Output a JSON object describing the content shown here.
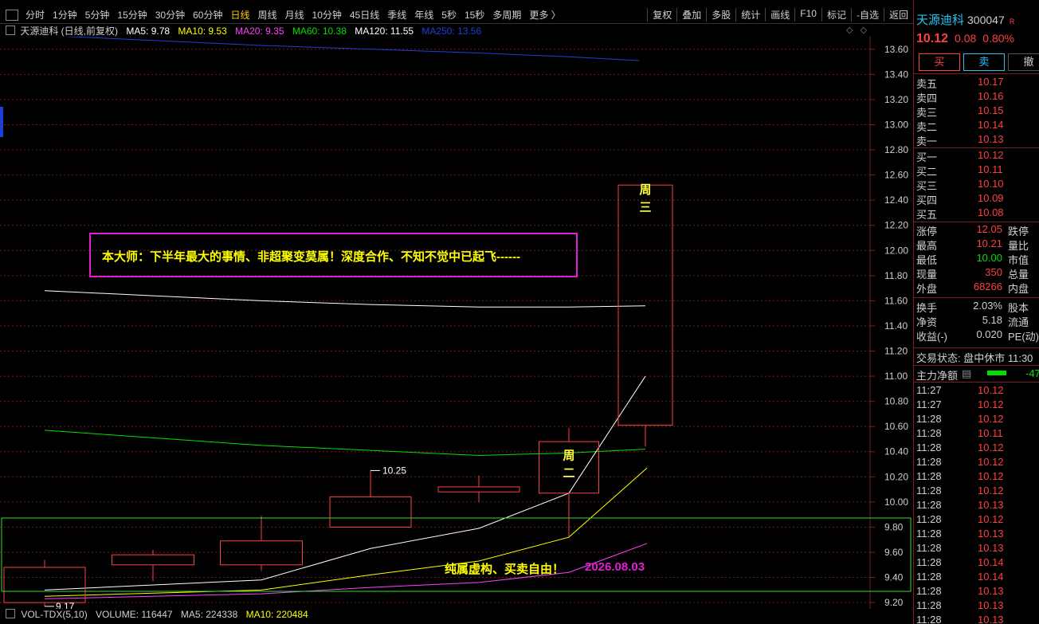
{
  "toolbar": {
    "tabs": [
      "分时",
      "1分钟",
      "5分钟",
      "15分钟",
      "30分钟",
      "60分钟",
      "日线",
      "周线",
      "月线",
      "10分钟",
      "45日线",
      "季线",
      "年线",
      "5秒",
      "15秒",
      "多周期",
      "更多 〉"
    ],
    "active_tab": "日线",
    "right_buttons": [
      "复权",
      "叠加",
      "多股",
      "统计",
      "画线",
      "F10",
      "标记",
      "-自选",
      "返回"
    ]
  },
  "legend": {
    "name": "天源迪科 (日线,前复权)",
    "ma5": "MA5: 9.78",
    "ma10": "MA10: 9.53",
    "ma20": "MA20: 9.35",
    "ma60": "MA60: 10.38",
    "ma120": "MA120: 11.55",
    "ma250": "MA250: 13.56"
  },
  "colors": {
    "up": "#ff4040",
    "down": "#27c2f5",
    "ma5": "#ffffff",
    "ma10": "#ffff00",
    "ma20": "#ff40ff",
    "ma60": "#00e000",
    "ma120": "#ffffff",
    "ma250": "#1d40d8",
    "grid": "#7a1d1d",
    "annot_border": "#e020d0"
  },
  "chart_data": {
    "type": "candlestick",
    "y_axis_ticks": [
      "13.60",
      "13.40",
      "13.20",
      "13.00",
      "12.80",
      "12.60",
      "12.40",
      "12.20",
      "12.00",
      "11.80",
      "11.60",
      "11.40",
      "11.20",
      "11.00",
      "10.80",
      "10.60",
      "10.40",
      "10.20",
      "10.00",
      "9.80",
      "9.60",
      "9.40",
      "9.20"
    ],
    "ylim": [
      9.15,
      13.7
    ],
    "candles": [
      {
        "open": 9.48,
        "close": 9.2,
        "high": 9.54,
        "low": 9.17
      },
      {
        "open": 9.5,
        "close": 9.58,
        "high": 9.62,
        "low": 9.37
      },
      {
        "open": 9.69,
        "close": 9.5,
        "high": 9.89,
        "low": 9.45
      },
      {
        "open": 9.8,
        "close": 10.04,
        "high": 10.25,
        "low": 9.8
      },
      {
        "open": 10.08,
        "close": 10.12,
        "high": 10.21,
        "low": 10.0
      },
      {
        "open": 10.07,
        "close": 10.48,
        "high": 10.59,
        "low": 9.72
      },
      {
        "open": 10.61,
        "close": 12.52,
        "high": 12.52,
        "low": 10.44
      }
    ],
    "high_label": "10.25",
    "low_label": "9.17",
    "ma5": [
      9.3,
      null,
      9.38,
      9.63,
      9.79,
      10.07,
      11.0
    ],
    "ma10": [
      9.25,
      null,
      9.3,
      9.42,
      9.53,
      9.72,
      10.27
    ],
    "ma20": [
      9.23,
      null,
      9.27,
      9.32,
      9.36,
      9.44,
      9.67
    ],
    "ma60": [
      10.57,
      10.51,
      10.45,
      10.41,
      10.37,
      10.39,
      10.42
    ],
    "ma120": [
      11.68,
      11.64,
      11.6,
      11.57,
      11.55,
      11.55,
      11.56
    ],
    "ma250": [
      13.71,
      13.67,
      13.63,
      13.6,
      13.57,
      13.54,
      13.51
    ],
    "candle_labels": [
      {
        "index": 5,
        "text": [
          "周",
          "二"
        ]
      },
      {
        "index": 6,
        "text": [
          "周",
          "三"
        ]
      }
    ]
  },
  "annotation": "本大师：下半年最大的事情、非超聚变莫属！深度合作、不知不觉中已起飞------",
  "disclaimer": "纯属虚构、买卖自由！",
  "disclaimer_date": "2026.08.03",
  "volume_bar": {
    "name": "VOL-TDX(5,10)",
    "volume": "VOLUME: 116447",
    "ma5": "MA5: 224338",
    "ma10": "MA10: 220484"
  },
  "quote": {
    "name": "天源迪科",
    "code": "300047",
    "price": "10.12",
    "change": "0.08",
    "pct": "0.80%",
    "buttons": [
      "买",
      "卖",
      "撤"
    ],
    "asks": [
      {
        "label": "卖五",
        "price": "10.17"
      },
      {
        "label": "卖四",
        "price": "10.16"
      },
      {
        "label": "卖三",
        "price": "10.15"
      },
      {
        "label": "卖二",
        "price": "10.14"
      },
      {
        "label": "卖一",
        "price": "10.13"
      }
    ],
    "bids": [
      {
        "label": "买一",
        "price": "10.12"
      },
      {
        "label": "买二",
        "price": "10.11"
      },
      {
        "label": "买三",
        "price": "10.10"
      },
      {
        "label": "买四",
        "price": "10.09"
      },
      {
        "label": "买五",
        "price": "10.08"
      }
    ],
    "stats": [
      {
        "l": "涨停",
        "v": "12.05",
        "l2": "跌停",
        "c": "#ff4040"
      },
      {
        "l": "最高",
        "v": "10.21",
        "l2": "量比",
        "c": "#ff4040"
      },
      {
        "l": "最低",
        "v": "10.00",
        "l2": "市值",
        "c": "#00e000"
      },
      {
        "l": "现量",
        "v": "350",
        "l2": "总量",
        "c": "#ff4040"
      },
      {
        "l": "外盘",
        "v": "68266",
        "l2": "内盘",
        "c": "#ff4040"
      },
      {
        "l": "换手",
        "v": "2.03%",
        "l2": "股本",
        "c": "#cfcfcf"
      },
      {
        "l": "净资",
        "v": "5.18",
        "l2": "流通",
        "c": "#cfcfcf"
      },
      {
        "l": "收益(-)",
        "v": "0.020",
        "l2": "PE(动)",
        "c": "#cfcfcf"
      }
    ],
    "trade_status": "交易状态: 盘中休市 11:30",
    "net_label": "主力净额",
    "net_value": "-47",
    "ticks": [
      {
        "t": "11:27",
        "p": "10.12"
      },
      {
        "t": "11:27",
        "p": "10.12"
      },
      {
        "t": "11:28",
        "p": "10.12"
      },
      {
        "t": "11:28",
        "p": "10.11"
      },
      {
        "t": "11:28",
        "p": "10.12"
      },
      {
        "t": "11:28",
        "p": "10.12"
      },
      {
        "t": "11:28",
        "p": "10.12"
      },
      {
        "t": "11:28",
        "p": "10.12"
      },
      {
        "t": "11:28",
        "p": "10.13"
      },
      {
        "t": "11:28",
        "p": "10.12"
      },
      {
        "t": "11:28",
        "p": "10.13"
      },
      {
        "t": "11:28",
        "p": "10.13"
      },
      {
        "t": "11:28",
        "p": "10.14"
      },
      {
        "t": "11:28",
        "p": "10.14"
      },
      {
        "t": "11:28",
        "p": "10.13"
      },
      {
        "t": "11:28",
        "p": "10.13"
      },
      {
        "t": "11:28",
        "p": "10.13"
      }
    ]
  }
}
